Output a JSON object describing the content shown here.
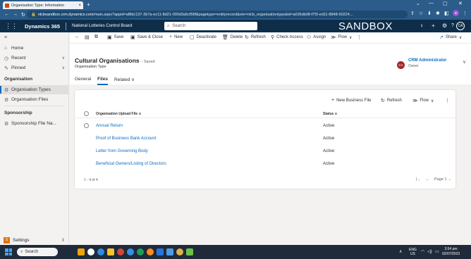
{
  "browser": {
    "tab_title": "Organisation Type: Information",
    "tab_close": "×",
    "new_tab": "+",
    "url_host": "nlcboandbox.crm.dynamics.com",
    "url_path": "/main.aspx?appid=af8dc137-2b7a-ec11-8d21-000d3a5cf58f&pagetype=entityrecord&etn=nlcb_organisationtype&id=a036db08-f7f3-ed11-8848-00224...",
    "window_controls": [
      "⌄",
      "—",
      "▢",
      "✕"
    ]
  },
  "header": {
    "app_name": "Dynamics 365",
    "environment": "National Lotteries Control Board",
    "search_placeholder": "Search",
    "sandbox_label": "SANDBOX",
    "user_initials": "CA"
  },
  "sidebar": {
    "items": [
      {
        "label": "Home",
        "icon": "home-icon"
      },
      {
        "label": "Recent",
        "icon": "clock-icon"
      },
      {
        "label": "Pinned",
        "icon": "pin-icon"
      }
    ],
    "groups": [
      {
        "label": "Organisation",
        "items": [
          {
            "label": "Organisation Types",
            "active": true
          },
          {
            "label": "Organisation Files"
          }
        ]
      },
      {
        "label": "Sponsorship",
        "items": [
          {
            "label": "Sponsorship File Na..."
          }
        ]
      }
    ],
    "area_badge": "S",
    "area_label": "Settings"
  },
  "commands": {
    "save": "Save",
    "save_close": "Save & Close",
    "new": "New",
    "deactivate": "Deactivate",
    "delete": "Delete",
    "refresh": "Refresh",
    "check_access": "Check Access",
    "assign": "Assign",
    "flow": "Flow",
    "share": "Share"
  },
  "record": {
    "title": "Cultural Organisations",
    "saved_status": "- Saved",
    "entity": "Organisation Type",
    "owner_initials": "CA",
    "owner_name": "CRM Administrator",
    "owner_role": "Owner"
  },
  "tabs": [
    {
      "label": "General"
    },
    {
      "label": "Files",
      "selected": true
    },
    {
      "label": "Related"
    }
  ],
  "grid": {
    "commands": {
      "new": "New Business File",
      "refresh": "Refresh",
      "flow": "Flow"
    },
    "columns": [
      "Organisation Upload File",
      "Status"
    ],
    "rows": [
      {
        "name": "Annual Return",
        "status": "Active"
      },
      {
        "name": "Proof of Business Bank Account",
        "status": "Active"
      },
      {
        "name": "Letter from Governing Body",
        "status": "Active"
      },
      {
        "name": "Beneficial Owners/Listing of Directors",
        "status": "Active"
      }
    ],
    "record_count": "1 - 4 of 4",
    "page_label": "Page 1"
  },
  "taskbar": {
    "search_placeholder": "Search",
    "language": "ENG",
    "region": "US",
    "time": "3:54 pm",
    "date": "02/07/2023"
  }
}
